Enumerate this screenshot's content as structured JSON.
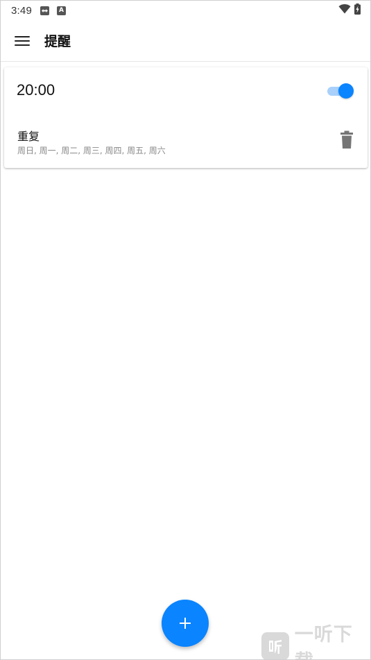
{
  "status_bar": {
    "time": "3:49",
    "notif_icon_a": "A"
  },
  "app_bar": {
    "title": "提醒"
  },
  "reminder": {
    "time": "20:00",
    "enabled": true,
    "repeat_label": "重复",
    "repeat_days": "周日, 周一, 周二, 周三, 周四, 周五, 周六"
  },
  "watermark": {
    "text": "一听下载"
  },
  "colors": {
    "accent": "#0a84ff",
    "toggle_track": "#a8d0fb",
    "secondary_text": "#888888",
    "icon_gray": "#757575"
  },
  "icons": {
    "menu": "hamburger-menu-icon",
    "delete": "trash-icon",
    "add": "plus-icon",
    "wifi": "wifi-icon",
    "battery": "battery-charging-icon"
  }
}
